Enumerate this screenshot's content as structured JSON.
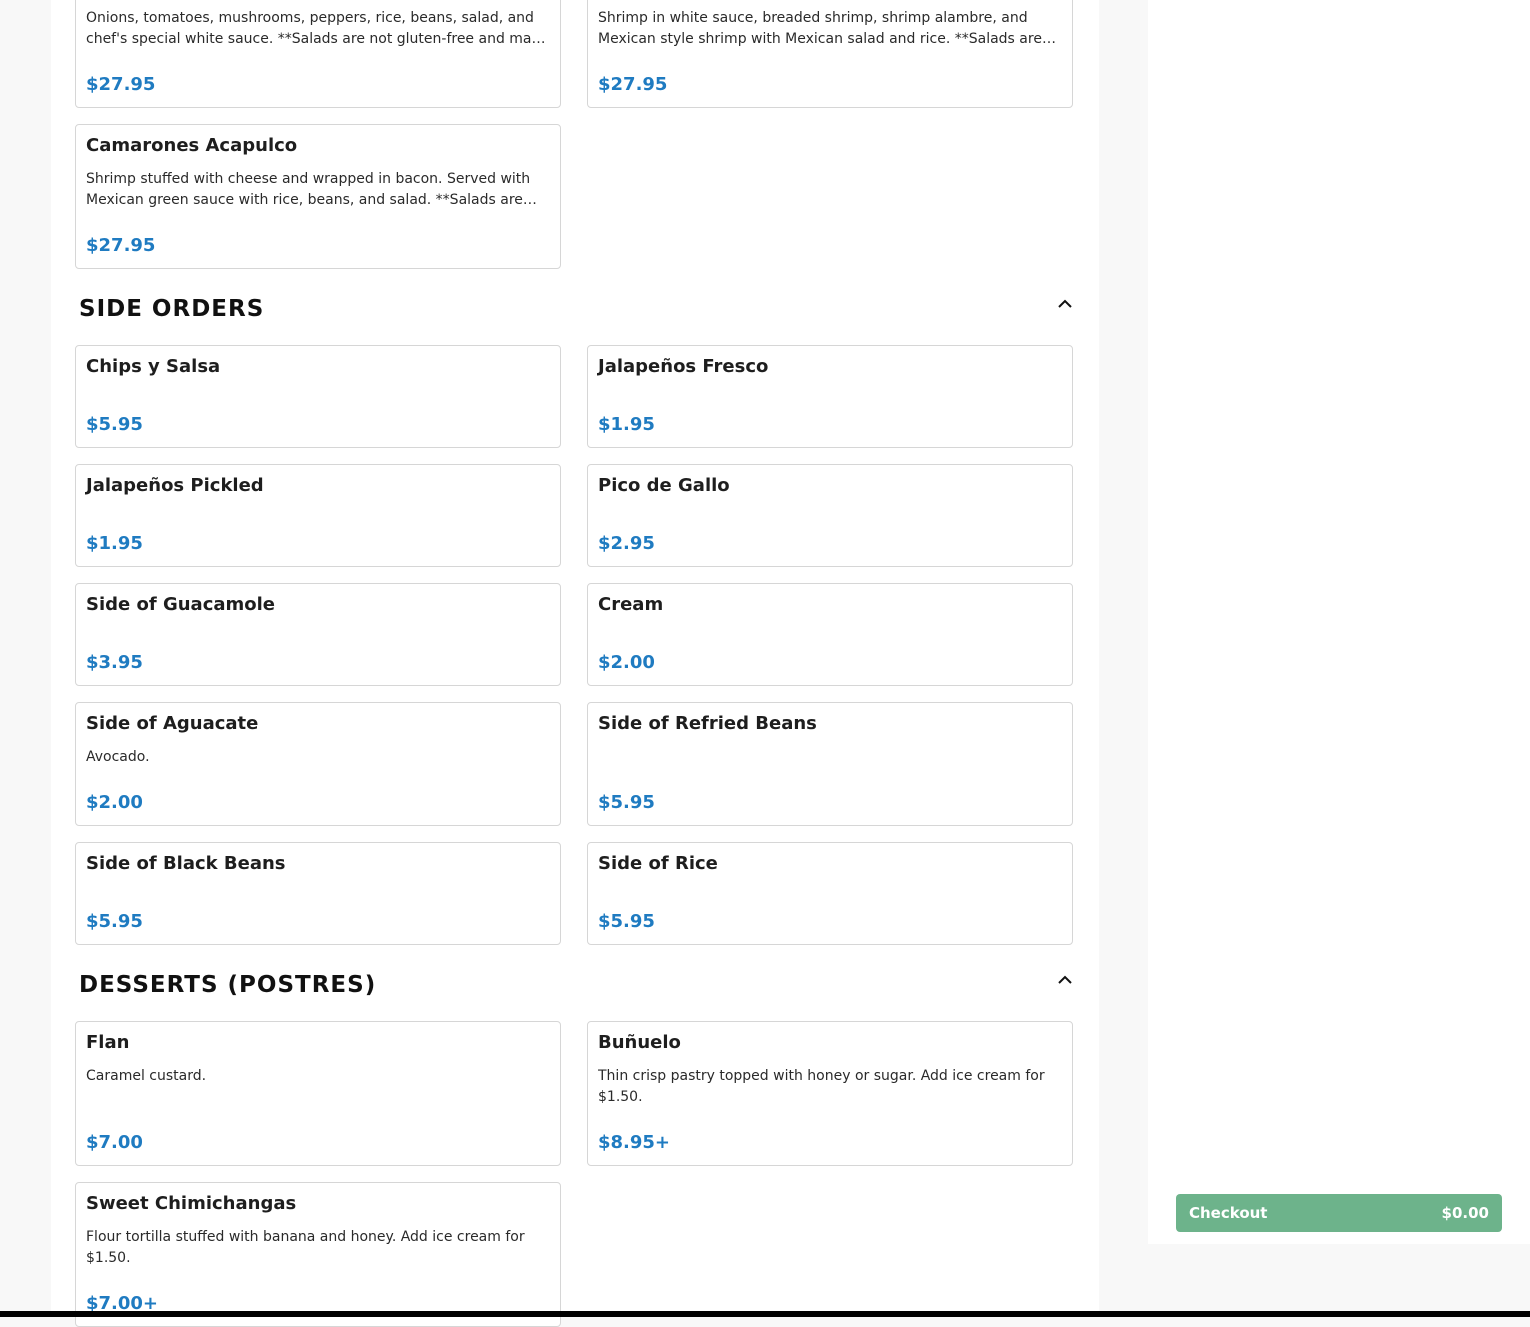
{
  "sections": {
    "side_orders": "SIDE ORDERS",
    "desserts": "DESSERTS (POSTRES)"
  },
  "top_items": [
    {
      "desc": "Onions, tomatoes, mushrooms, peppers, rice, beans, salad, and chef's special white sauce. **Salads are not gluten-free and may contain gluten.",
      "price": "$27.95"
    },
    {
      "desc": "Shrimp in white sauce, breaded shrimp, shrimp alambre, and Mexican style shrimp with Mexican salad and rice. **Salads are not gluten-free.",
      "price": "$27.95"
    },
    {
      "name": "Camarones Acapulco",
      "desc": "Shrimp stuffed with cheese and wrapped in bacon. Served with Mexican green sauce with rice, beans, and salad. **Salads are not gluten-free.",
      "price": "$27.95"
    }
  ],
  "side_items": [
    {
      "name": "Chips y Salsa",
      "price": "$5.95"
    },
    {
      "name": "Jalapeños Fresco",
      "price": "$1.95"
    },
    {
      "name": "Jalapeños Pickled",
      "price": "$1.95"
    },
    {
      "name": "Pico de Gallo",
      "price": "$2.95"
    },
    {
      "name": "Side of Guacamole",
      "price": "$3.95"
    },
    {
      "name": "Cream",
      "price": "$2.00"
    },
    {
      "name": "Side of Aguacate",
      "desc": "Avocado.",
      "price": "$2.00"
    },
    {
      "name": "Side of Refried Beans",
      "price": "$5.95"
    },
    {
      "name": "Side of Black Beans",
      "price": "$5.95"
    },
    {
      "name": "Side of Rice",
      "price": "$5.95"
    }
  ],
  "dessert_items": [
    {
      "name": "Flan",
      "desc": "Caramel custard.",
      "price": "$7.00"
    },
    {
      "name": "Buñuelo",
      "desc": "Thin crisp pastry topped with honey or sugar. Add ice cream for $1.50.",
      "price": "$8.95+"
    },
    {
      "name": "Sweet Chimichangas",
      "desc": "Flour tortilla stuffed with banana and honey. Add ice cream for $1.50.",
      "price": "$7.00+"
    }
  ],
  "checkout": {
    "label": "Checkout",
    "total": "$0.00"
  },
  "colors": {
    "price": "#1f7bc1",
    "checkout_bg": "#6db38b"
  },
  "icons": {
    "collapse": "chevron-up-icon"
  }
}
